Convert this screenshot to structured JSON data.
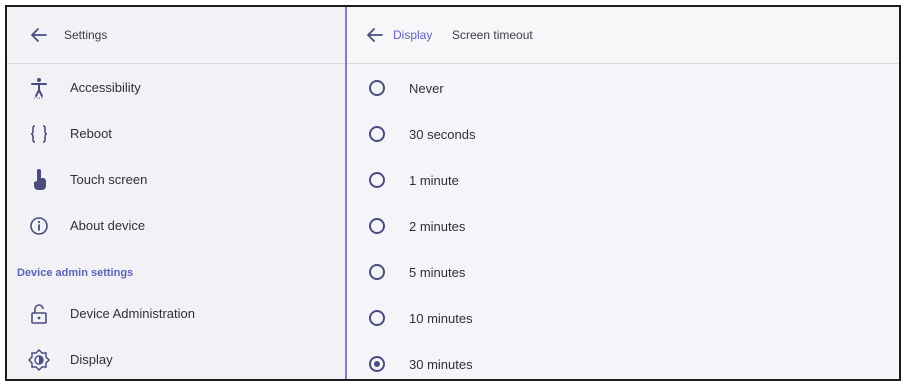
{
  "left_panel": {
    "header": {
      "title": "Settings"
    },
    "items": [
      {
        "label": "Accessibility",
        "icon": "accessibility-icon"
      },
      {
        "label": "Reboot",
        "icon": "braces-icon"
      },
      {
        "label": "Touch screen",
        "icon": "touch-icon"
      },
      {
        "label": "About device",
        "icon": "info-icon"
      }
    ],
    "section_title": "Device admin settings",
    "admin_items": [
      {
        "label": "Device Administration",
        "icon": "unlock-icon"
      },
      {
        "label": "Display",
        "icon": "brightness-icon"
      }
    ]
  },
  "right_panel": {
    "breadcrumb": {
      "parent": "Display",
      "current": "Screen timeout"
    },
    "options": [
      {
        "label": "Never",
        "selected": false
      },
      {
        "label": "30 seconds",
        "selected": false
      },
      {
        "label": "1 minute",
        "selected": false
      },
      {
        "label": "2 minutes",
        "selected": false
      },
      {
        "label": "5 minutes",
        "selected": false
      },
      {
        "label": "10 minutes",
        "selected": false
      },
      {
        "label": "30 minutes",
        "selected": true
      }
    ]
  },
  "colors": {
    "accent": "#5e62b8",
    "divider": "#7b7fc4",
    "radio": "#4a4d7e"
  }
}
